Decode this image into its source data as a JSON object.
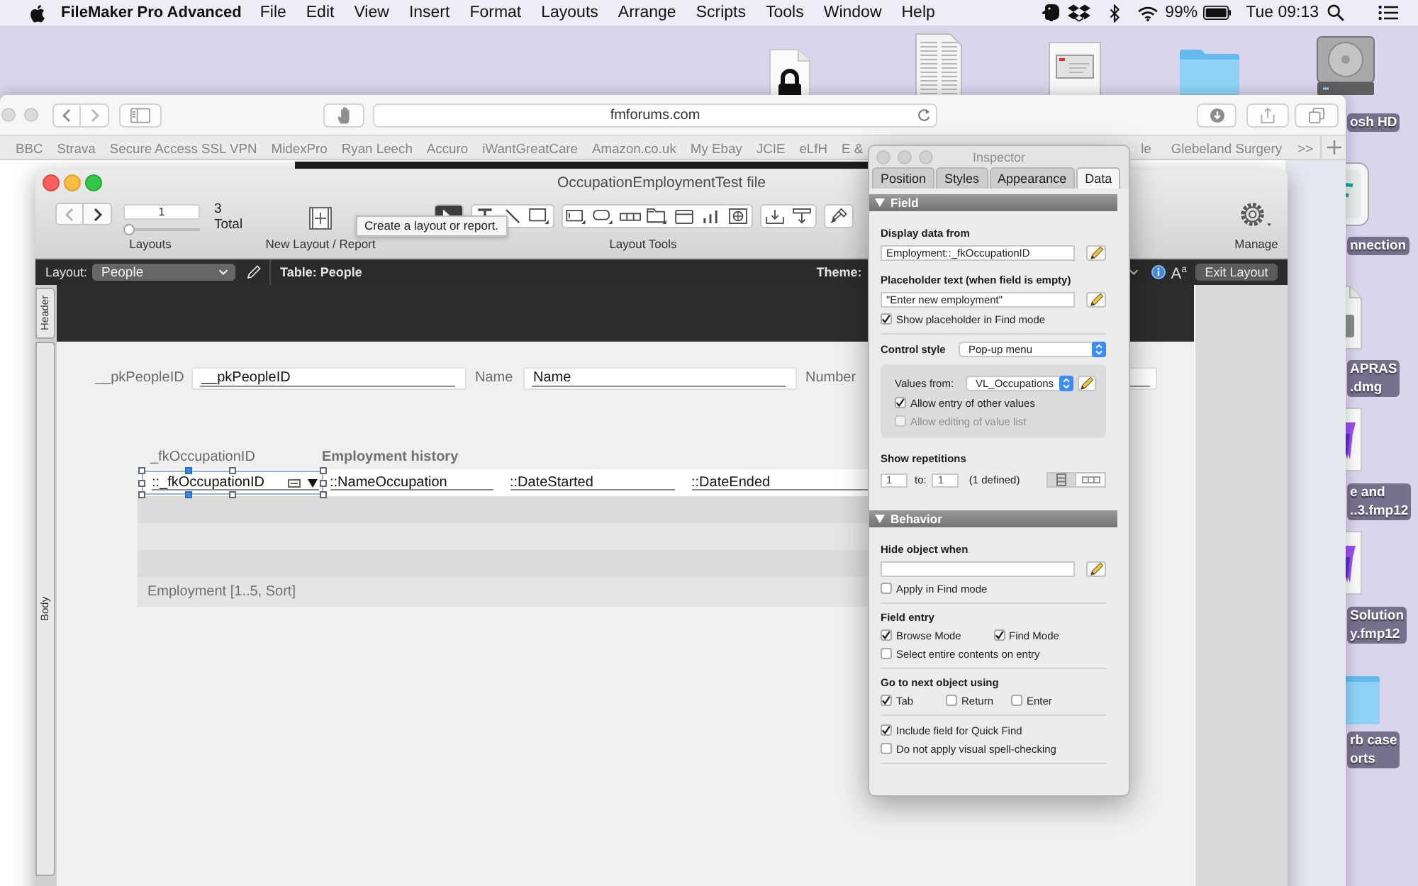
{
  "menu_bar": {
    "app_name": "FileMaker Pro Advanced",
    "menus": [
      "File",
      "Edit",
      "View",
      "Insert",
      "Format",
      "Layouts",
      "Arrange",
      "Scripts",
      "Tools",
      "Window",
      "Help"
    ],
    "battery": "99%",
    "clock": "Tue 09:13"
  },
  "desktop_icons": [
    {
      "kind": "lock-document"
    },
    {
      "kind": "list-document"
    },
    {
      "kind": "screenshot-document"
    },
    {
      "kind": "folder"
    },
    {
      "kind": "hard-disk",
      "label_lines": [
        "osh HD"
      ]
    },
    {
      "kind": "network",
      "label_lines": [
        "nnection"
      ]
    },
    {
      "kind": "disk-image",
      "label_lines": [
        "APRAS",
        ".dmg"
      ]
    },
    {
      "kind": "fmp-file",
      "label_lines": [
        "e and",
        "..3.fmp12"
      ]
    },
    {
      "kind": "fmp-file",
      "label_lines": [
        "Solution",
        "y.fmp12"
      ]
    },
    {
      "kind": "folder",
      "label_lines": [
        "rb case",
        "orts"
      ]
    }
  ],
  "browser": {
    "url": "fmforums.com",
    "bookmarks": [
      "BBC",
      "Strava",
      "Secure Access SSL VPN",
      "MidexPro",
      "Ryan Leech",
      "Accuro",
      "iWantGreatCare",
      "Amazon.co.uk",
      "My Ebay",
      "JCIE",
      "eLfH",
      "E &"
    ],
    "bookmarks_right": [
      "le",
      "Glebeland Surgery"
    ],
    "more_bookmarks": ">>"
  },
  "filemaker": {
    "title": "OccupationEmploymentTest file",
    "toolbar": {
      "record": "1",
      "record_slider": {
        "level": 0
      },
      "count": "3",
      "count_label": "Total",
      "layouts_label": "Layouts",
      "new_layout_label": "New Layout / Report",
      "tool_groups": [
        [
          {
            "kind": "pointer",
            "selected": true
          }
        ],
        [
          {
            "kind": "text",
            "selected": false
          },
          {
            "kind": "line",
            "selected": false
          },
          {
            "kind": "rectangle",
            "selected": false
          }
        ],
        [
          {
            "kind": "field",
            "selected": false
          },
          {
            "kind": "button",
            "selected": false
          },
          {
            "kind": "button-bar",
            "selected": false
          },
          {
            "kind": "popover",
            "selected": false
          },
          {
            "kind": "panel",
            "selected": false
          },
          {
            "kind": "chart",
            "selected": false
          },
          {
            "kind": "web-viewer",
            "selected": false
          }
        ],
        [
          {
            "kind": "insert-field",
            "selected": false
          },
          {
            "kind": "insert-part",
            "selected": false
          }
        ],
        [
          {
            "kind": "format-painter",
            "selected": false
          }
        ]
      ],
      "tools_label": "Layout Tools",
      "manage_label": "Manage",
      "tooltip": "Create a layout or report."
    },
    "layout_bar": {
      "layout_label": "Layout:",
      "layout": "People",
      "table": "Table: People",
      "theme_label": "Theme:",
      "text_style_button": "A$^{a}$",
      "exit_button": "Exit Layout"
    },
    "parts": [
      {
        "kind": "header",
        "label": "Header"
      },
      {
        "kind": "body",
        "label": "Body"
      }
    ],
    "fields": [
      {
        "label": "__pkPeopleID",
        "value": "__pkPeopleID"
      },
      {
        "label": "Name",
        "value": "Name"
      },
      {
        "label": "Number"
      }
    ],
    "portal": {
      "field_label": "_fkOccupationID",
      "title": "Employment history",
      "fields": [
        {
          "kind": "popup",
          "value": "::_fkOccupationID",
          "selected": true
        },
        {
          "kind": "edit",
          "value": "::NameOccupation",
          "selected": false
        },
        {
          "kind": "edit",
          "value": "::DateStarted",
          "selected": false
        },
        {
          "kind": "edit",
          "value": "::DateEnded",
          "selected": false
        }
      ],
      "info": "Employment [1..5, Sort]"
    }
  },
  "inspector": {
    "title": "Inspector",
    "tabs": [
      {
        "label": "Position",
        "selected": false
      },
      {
        "label": "Styles",
        "selected": false
      },
      {
        "label": "Appearance",
        "selected": false
      },
      {
        "label": "Data",
        "selected": true
      }
    ],
    "sections": [
      {
        "title": "Field",
        "expanded": true,
        "rows": [
          {
            "kind": "heading",
            "text": "Display data from"
          },
          {
            "kind": "field",
            "value": "Employment::_fkOccupationID"
          },
          {
            "kind": "heading",
            "text": "Placeholder text (when field is empty)"
          },
          {
            "kind": "field",
            "value": "\"Enter new employment\""
          },
          {
            "kind": "checks",
            "items": [
              {
                "label": "Show placeholder in Find mode",
                "checked": true,
                "disabled": false
              }
            ]
          },
          {
            "kind": "divider"
          },
          {
            "kind": "popup",
            "label": "Control style",
            "value": "Pop-up menu",
            "edit_button": false
          },
          {
            "kind": "group",
            "rows": [
              {
                "kind": "popup",
                "label": "Values from:",
                "value": "VL_Occupations",
                "edit_button": true
              },
              {
                "kind": "checks",
                "items": [
                  {
                    "label": "Allow entry of other values",
                    "checked": true,
                    "disabled": false
                  }
                ]
              },
              {
                "kind": "checks",
                "items": [
                  {
                    "label": "Allow editing of value list",
                    "checked": false,
                    "disabled": true
                  }
                ]
              }
            ]
          },
          {
            "kind": "heading",
            "text": "Show repetitions"
          },
          {
            "kind": "repetitions",
            "from": "1",
            "to_label": "to:",
            "to": "1",
            "note": "(1 defined)",
            "orientations": [
              {
                "kind": "vertical",
                "selected": true
              },
              {
                "kind": "horizontal",
                "selected": false
              }
            ]
          }
        ]
      },
      {
        "title": "Behavior",
        "expanded": true,
        "rows": [
          {
            "kind": "heading",
            "text": "Hide object when"
          },
          {
            "kind": "field"
          },
          {
            "kind": "checks",
            "items": [
              {
                "label": "Apply in Find mode",
                "checked": false,
                "disabled": false
              }
            ]
          },
          {
            "kind": "divider"
          },
          {
            "kind": "heading",
            "text": "Field entry"
          },
          {
            "kind": "checks",
            "items": [
              {
                "label": "Browse Mode",
                "checked": true,
                "disabled": false
              },
              {
                "label": "Find Mode",
                "checked": true,
                "disabled": false
              }
            ]
          },
          {
            "kind": "checks",
            "items": [
              {
                "label": "Select entire contents on entry",
                "checked": false,
                "disabled": false
              }
            ]
          },
          {
            "kind": "divider"
          },
          {
            "kind": "heading",
            "text": "Go to next object using"
          },
          {
            "kind": "checks",
            "items": [
              {
                "label": "Tab",
                "checked": true,
                "disabled": false
              },
              {
                "label": "Return",
                "checked": false,
                "disabled": false
              },
              {
                "label": "Enter",
                "checked": false,
                "disabled": false
              }
            ]
          },
          {
            "kind": "divider"
          },
          {
            "kind": "checks",
            "items": [
              {
                "label": "Include field for Quick Find",
                "checked": true,
                "disabled": false
              }
            ]
          },
          {
            "kind": "checks",
            "items": [
              {
                "label": "Do not apply visual spell-checking",
                "checked": false,
                "disabled": false
              }
            ]
          },
          {
            "kind": "divider"
          }
        ]
      }
    ]
  }
}
